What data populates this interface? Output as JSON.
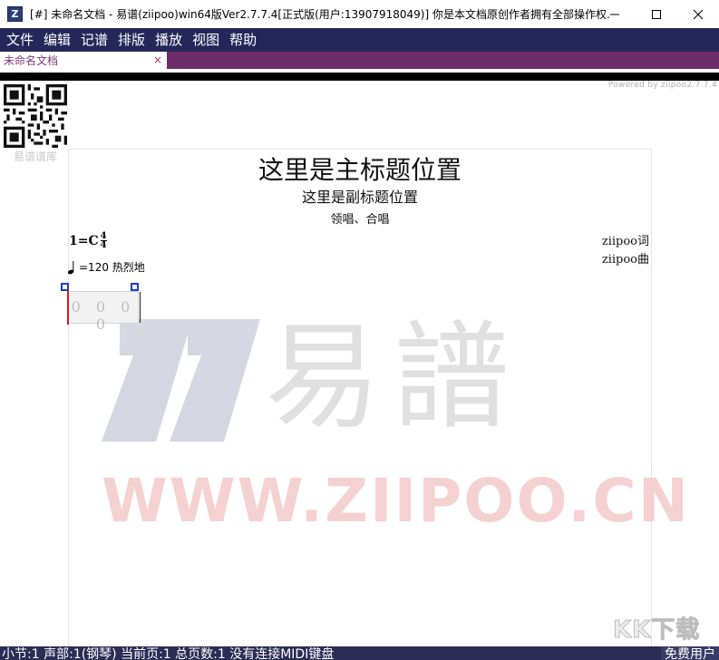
{
  "window": {
    "title": "[#] 未命名文档 - 易谱(ziipoo)win64版Ver2.7.7.4[正式版(用户:13907918049)] 你是本文档原创作者拥有全部操作权...",
    "icon_letter": "Z",
    "controls": [
      "minimize-icon",
      "maximize-icon",
      "close-icon"
    ]
  },
  "menu": {
    "items": [
      {
        "label": "文件"
      },
      {
        "label": "编辑"
      },
      {
        "label": "记谱"
      },
      {
        "label": "排版"
      },
      {
        "label": "播放"
      },
      {
        "label": "视图"
      },
      {
        "label": "帮助"
      }
    ]
  },
  "tab": {
    "label": "未命名文档",
    "close": "×"
  },
  "workspace": {
    "powered_by": "Powered by ziipoo2.7.7.4",
    "qr_caption": "易谱谱库"
  },
  "score": {
    "main_title": "这里是主标题位置",
    "sub_title": "这里是副标题位置",
    "performer": "领唱、合唱",
    "key": "1=C",
    "time_numerator": "4",
    "time_denominator": "4",
    "lyricist": "ziipoo词",
    "composer": "ziipoo曲",
    "tempo": "=120 热烈地",
    "measure_notes": "0 0 0 0"
  },
  "watermark": {
    "brand": "易譜",
    "url": "WWW.ZIIPOO.CN",
    "kk": "KK下载"
  },
  "status": {
    "text": "小节:1 声部:1(钢琴) 当前页:1 总页数:1 没有连接MIDI键盘",
    "right": "免费用户"
  },
  "colors": {
    "menubar": "#25275a",
    "tabbar": "#6c2d68",
    "statusbar": "#2b2d55",
    "selection_handle": "#1a3cd6",
    "cursor": "#e01515"
  }
}
